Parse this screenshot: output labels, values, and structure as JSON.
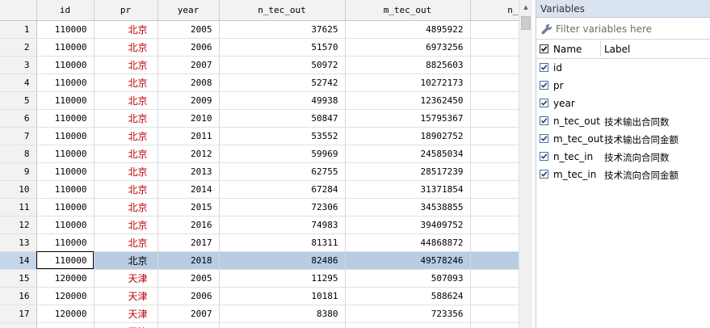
{
  "grid": {
    "columns": [
      "id",
      "pr",
      "year",
      "n_tec_out",
      "m_tec_out",
      "n_"
    ],
    "rows": [
      {
        "n": "1",
        "id": "110000",
        "pr": "北京",
        "year": "2005",
        "n_tec_out": "37625",
        "m_tec_out": "4895922"
      },
      {
        "n": "2",
        "id": "110000",
        "pr": "北京",
        "year": "2006",
        "n_tec_out": "51570",
        "m_tec_out": "6973256"
      },
      {
        "n": "3",
        "id": "110000",
        "pr": "北京",
        "year": "2007",
        "n_tec_out": "50972",
        "m_tec_out": "8825603"
      },
      {
        "n": "4",
        "id": "110000",
        "pr": "北京",
        "year": "2008",
        "n_tec_out": "52742",
        "m_tec_out": "10272173"
      },
      {
        "n": "5",
        "id": "110000",
        "pr": "北京",
        "year": "2009",
        "n_tec_out": "49938",
        "m_tec_out": "12362450"
      },
      {
        "n": "6",
        "id": "110000",
        "pr": "北京",
        "year": "2010",
        "n_tec_out": "50847",
        "m_tec_out": "15795367"
      },
      {
        "n": "7",
        "id": "110000",
        "pr": "北京",
        "year": "2011",
        "n_tec_out": "53552",
        "m_tec_out": "18902752"
      },
      {
        "n": "8",
        "id": "110000",
        "pr": "北京",
        "year": "2012",
        "n_tec_out": "59969",
        "m_tec_out": "24585034"
      },
      {
        "n": "9",
        "id": "110000",
        "pr": "北京",
        "year": "2013",
        "n_tec_out": "62755",
        "m_tec_out": "28517239"
      },
      {
        "n": "10",
        "id": "110000",
        "pr": "北京",
        "year": "2014",
        "n_tec_out": "67284",
        "m_tec_out": "31371854"
      },
      {
        "n": "11",
        "id": "110000",
        "pr": "北京",
        "year": "2015",
        "n_tec_out": "72306",
        "m_tec_out": "34538855"
      },
      {
        "n": "12",
        "id": "110000",
        "pr": "北京",
        "year": "2016",
        "n_tec_out": "74983",
        "m_tec_out": "39409752"
      },
      {
        "n": "13",
        "id": "110000",
        "pr": "北京",
        "year": "2017",
        "n_tec_out": "81311",
        "m_tec_out": "44868872"
      },
      {
        "n": "14",
        "id": "110000",
        "pr": "北京",
        "year": "2018",
        "n_tec_out": "82486",
        "m_tec_out": "49578246"
      },
      {
        "n": "15",
        "id": "120000",
        "pr": "天津",
        "year": "2005",
        "n_tec_out": "11295",
        "m_tec_out": "507093"
      },
      {
        "n": "16",
        "id": "120000",
        "pr": "天津",
        "year": "2006",
        "n_tec_out": "10181",
        "m_tec_out": "588624"
      },
      {
        "n": "17",
        "id": "120000",
        "pr": "天津",
        "year": "2007",
        "n_tec_out": "8380",
        "m_tec_out": "723356"
      },
      {
        "n": "",
        "id": "",
        "pr": "天津",
        "year": "",
        "n_tec_out": "",
        "m_tec_out": ""
      }
    ],
    "selected_row": "14"
  },
  "variables_panel": {
    "title": "Variables",
    "filter_placeholder": "Filter variables here",
    "header_name": "Name",
    "header_label": "Label",
    "items": [
      {
        "name": "id",
        "label": "",
        "checked": true
      },
      {
        "name": "pr",
        "label": "",
        "checked": true
      },
      {
        "name": "year",
        "label": "",
        "checked": true
      },
      {
        "name": "n_tec_out",
        "label": "技术输出合同数",
        "checked": true
      },
      {
        "name": "m_tec_out",
        "label": "技术输出合同金额",
        "checked": true
      },
      {
        "name": "n_tec_in",
        "label": "技术流向合同数",
        "checked": true
      },
      {
        "name": "m_tec_in",
        "label": "技术流向合同金额",
        "checked": true
      }
    ]
  },
  "icons": {
    "filter": "wrench-icon",
    "scroll_up": "scroll-up-arrow-icon",
    "checkbox": "checkbox-checked-icon"
  },
  "colors": {
    "selected_row": "#b8cce4",
    "string_text": "#c00000",
    "panel_title_bg": "#dae3f0"
  }
}
